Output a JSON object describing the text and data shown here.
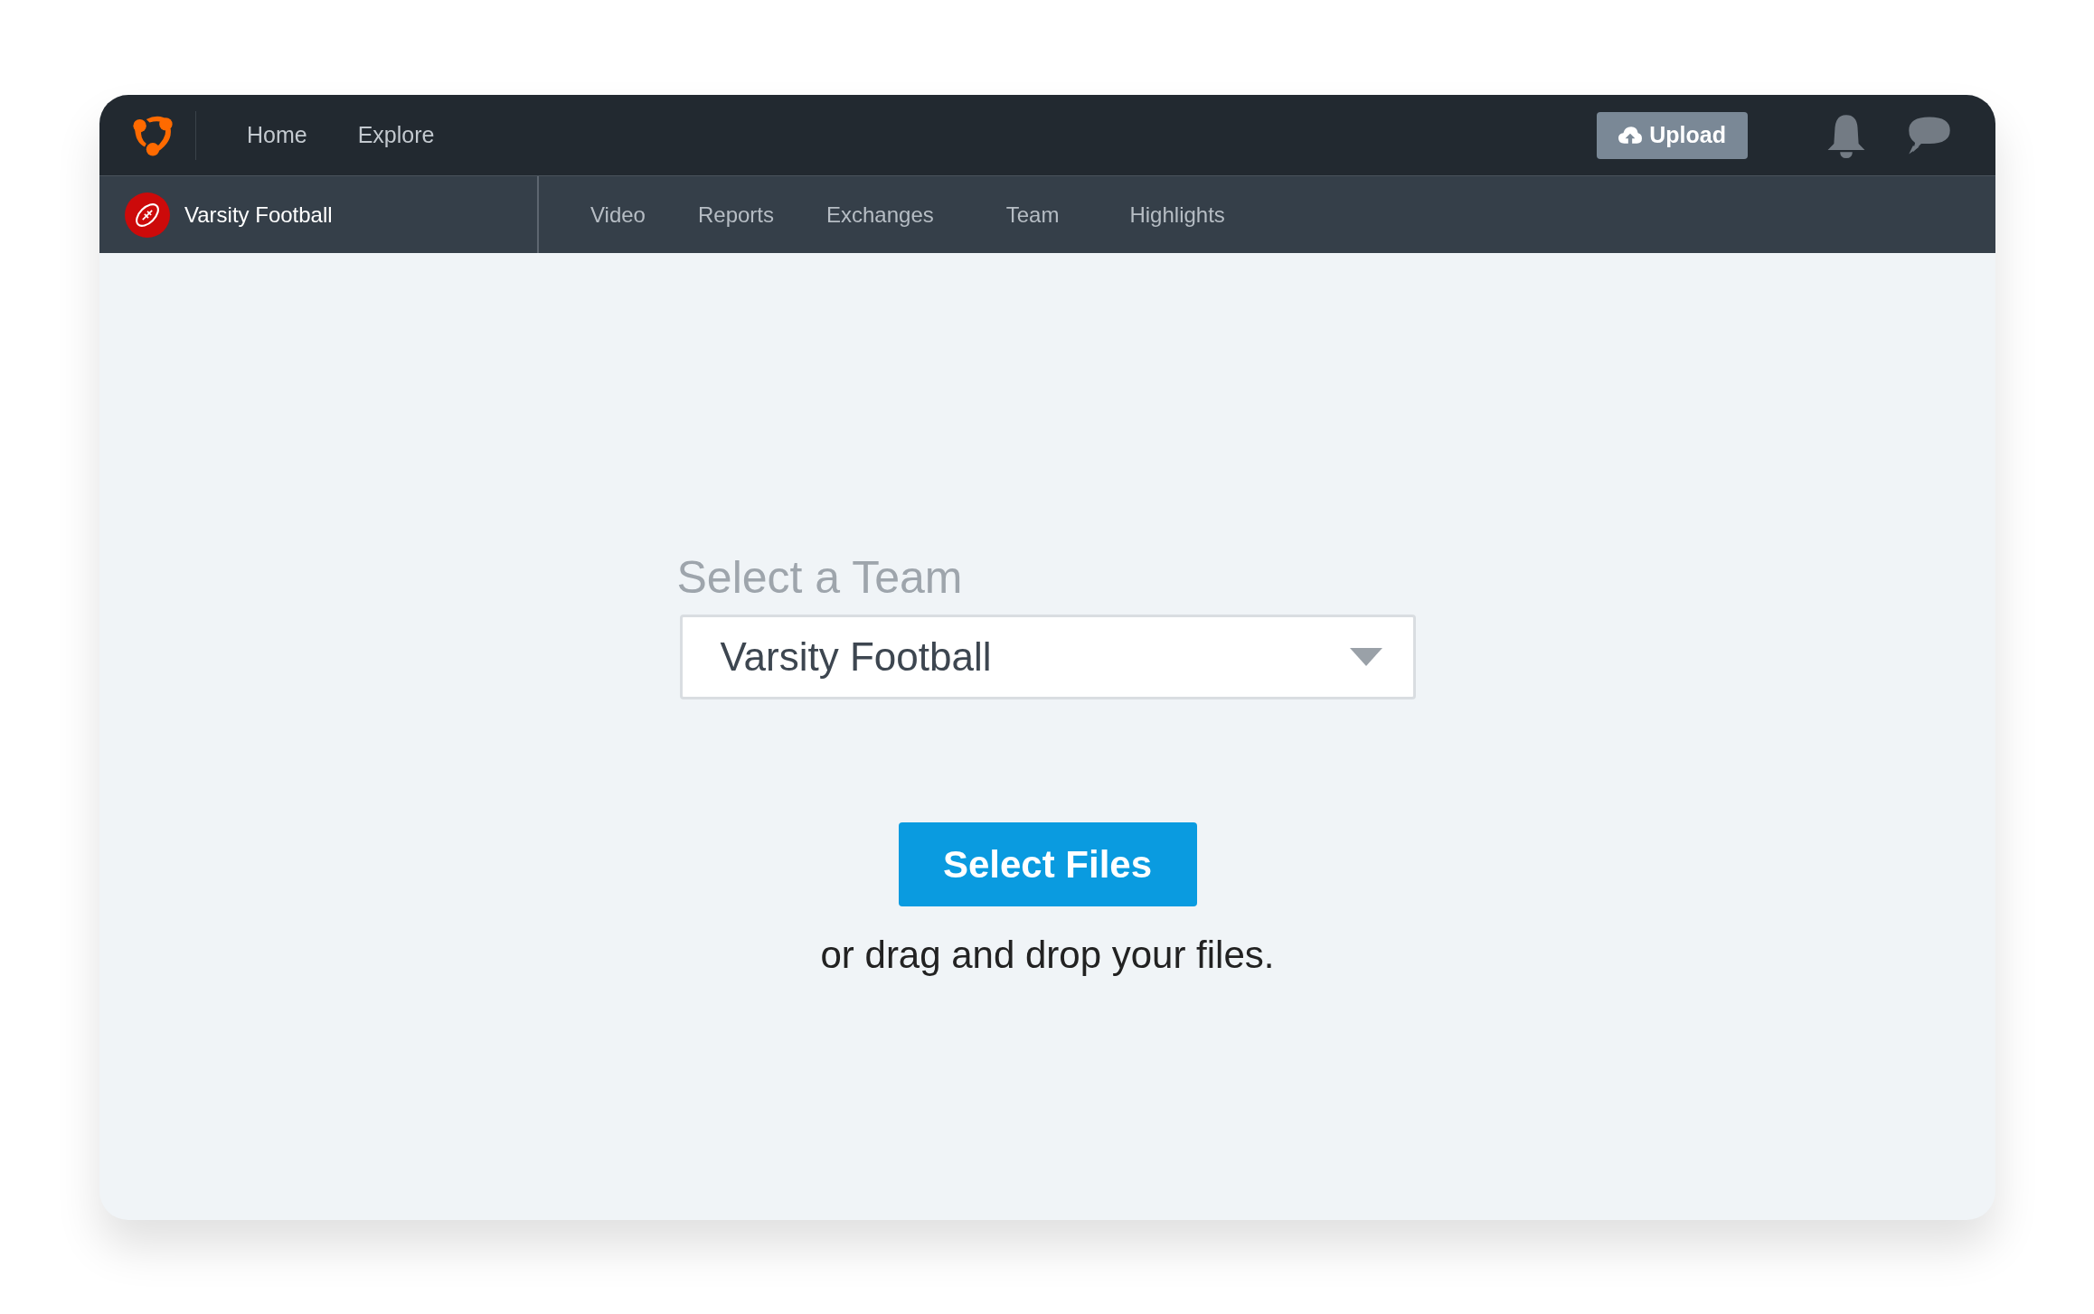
{
  "top_nav": {
    "links": [
      {
        "label": "Home"
      },
      {
        "label": "Explore"
      }
    ],
    "upload_button": "Upload"
  },
  "team_bar": {
    "team_name": "Varsity Football",
    "tabs": [
      {
        "label": "Video"
      },
      {
        "label": "Reports"
      },
      {
        "label": "Exchanges"
      },
      {
        "label": "Team"
      },
      {
        "label": "Highlights"
      }
    ]
  },
  "upload": {
    "team_label": "Select a Team",
    "team_select": {
      "value": "Varsity Football"
    },
    "select_button": "Select Files",
    "hint": "or drag and drop your files."
  }
}
